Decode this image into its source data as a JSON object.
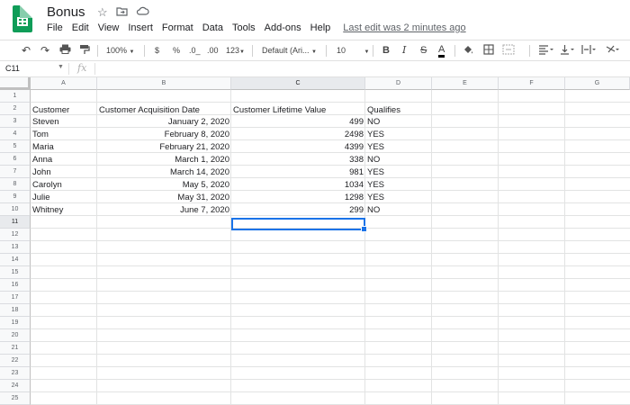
{
  "app": {
    "title": "Bonus",
    "last_edit": "Last edit was 2 minutes ago",
    "menu": [
      "File",
      "Edit",
      "View",
      "Insert",
      "Format",
      "Data",
      "Tools",
      "Add-ons",
      "Help"
    ]
  },
  "toolbar": {
    "zoom": "100%",
    "currency": "$",
    "percent": "%",
    "decimal_decrease": ".0_",
    "decimal_increase": ".00",
    "more_formats": "123",
    "font": "Default (Ari...",
    "font_size": "10",
    "bold": "B",
    "italic": "I",
    "strikethrough": "S",
    "text_color": "A"
  },
  "formula_bar": {
    "cell_ref": "C11",
    "fx": "fx",
    "value": ""
  },
  "columns": [
    "A",
    "B",
    "C",
    "D",
    "E",
    "F",
    "G"
  ],
  "rows": [
    "1",
    "2",
    "3",
    "4",
    "5",
    "6",
    "7",
    "8",
    "9",
    "10",
    "11",
    "12",
    "13",
    "14",
    "15",
    "16",
    "17",
    "18",
    "19",
    "20",
    "21",
    "22",
    "23",
    "24",
    "25"
  ],
  "sheet": {
    "headers": [
      "Customer",
      "Customer Acquisition Date",
      "Customer Lifetime Value",
      "Qualifies"
    ],
    "data": [
      [
        "Steven",
        "January 2, 2020",
        "499",
        "NO"
      ],
      [
        "Tom",
        "February 8, 2020",
        "2498",
        "YES"
      ],
      [
        "Maria",
        "February 21, 2020",
        "4399",
        "YES"
      ],
      [
        "Anna",
        "March 1, 2020",
        "338",
        "NO"
      ],
      [
        "John",
        "March 14, 2020",
        "981",
        "YES"
      ],
      [
        "Carolyn",
        "May 5, 2020",
        "1034",
        "YES"
      ],
      [
        "Julie",
        "May 31, 2020",
        "1298",
        "YES"
      ],
      [
        "Whitney",
        "June 7, 2020",
        "299",
        "NO"
      ]
    ]
  },
  "colors": {
    "accent": "#1a73e8",
    "sheets_green": "#0f9d58"
  }
}
